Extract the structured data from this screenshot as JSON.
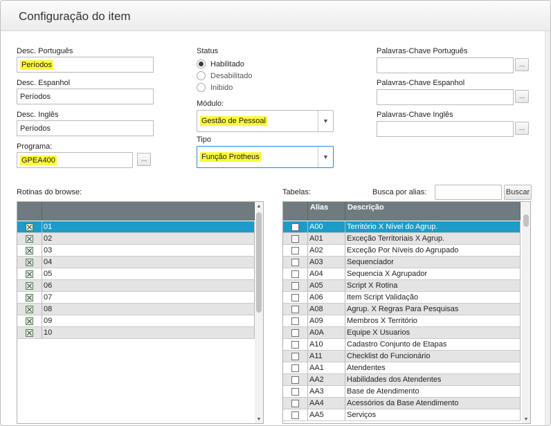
{
  "window": {
    "title": "Configuração do item"
  },
  "form": {
    "desc_pt": {
      "label": "Desc. Português",
      "value": "Períodos"
    },
    "desc_es": {
      "label": "Desc. Espanhol",
      "value": "Períodos"
    },
    "desc_en": {
      "label": "Desc. Inglês",
      "value": "Períodos"
    },
    "programa": {
      "label": "Programa:",
      "value": "GPEA400",
      "button": "..."
    },
    "status": {
      "label": "Status",
      "options": [
        {
          "label": "Habilitado",
          "selected": true
        },
        {
          "label": "Desabilitado",
          "selected": false
        },
        {
          "label": "Inibido",
          "selected": false
        }
      ]
    },
    "modulo": {
      "label": "Módulo:",
      "value": "Gestão de Pessoal"
    },
    "tipo": {
      "label": "Tipo",
      "value": "Função Protheus"
    },
    "kw_pt": {
      "label": "Palavras-Chave Português",
      "value": "",
      "button": "..."
    },
    "kw_es": {
      "label": "Palavras-Chave Espanhol",
      "value": "",
      "button": "..."
    },
    "kw_en": {
      "label": "Palavras-Chave Inglês",
      "value": "",
      "button": "..."
    }
  },
  "rotinas": {
    "label": "Rotinas do browse:",
    "rows": [
      {
        "value": "01",
        "checked": true,
        "selected": true
      },
      {
        "value": "02",
        "checked": true,
        "selected": false
      },
      {
        "value": "03",
        "checked": true,
        "selected": false
      },
      {
        "value": "04",
        "checked": true,
        "selected": false
      },
      {
        "value": "05",
        "checked": true,
        "selected": false
      },
      {
        "value": "06",
        "checked": true,
        "selected": false
      },
      {
        "value": "07",
        "checked": true,
        "selected": false
      },
      {
        "value": "08",
        "checked": true,
        "selected": false
      },
      {
        "value": "09",
        "checked": true,
        "selected": false
      },
      {
        "value": "10",
        "checked": true,
        "selected": false
      }
    ]
  },
  "tabelas": {
    "label": "Tabelas:",
    "search_label": "Busca por alias:",
    "search_value": "",
    "search_button": "Buscar",
    "columns": [
      "Alias",
      "Descrição"
    ],
    "rows": [
      {
        "alias": "A00",
        "desc": "Território X Nível do Agrup.",
        "selected": true
      },
      {
        "alias": "A01",
        "desc": "Exceção Territoriais X Agrup.",
        "selected": false
      },
      {
        "alias": "A02",
        "desc": "Exceção Por Níveis do Agrupado",
        "selected": false
      },
      {
        "alias": "A03",
        "desc": "Sequenciador",
        "selected": false
      },
      {
        "alias": "A04",
        "desc": "Sequencia X Agrupador",
        "selected": false
      },
      {
        "alias": "A05",
        "desc": "Script X Rotina",
        "selected": false
      },
      {
        "alias": "A06",
        "desc": "Item Script Validação",
        "selected": false
      },
      {
        "alias": "A08",
        "desc": "Agrup. X Regras Para Pesquisas",
        "selected": false
      },
      {
        "alias": "A09",
        "desc": "Membros X Território",
        "selected": false
      },
      {
        "alias": "A0A",
        "desc": "Equipe X Usuarios",
        "selected": false
      },
      {
        "alias": "A10",
        "desc": "Cadastro Conjunto de Etapas",
        "selected": false
      },
      {
        "alias": "A11",
        "desc": "Checklist do Funcionário",
        "selected": false
      },
      {
        "alias": "AA1",
        "desc": "Atendentes",
        "selected": false
      },
      {
        "alias": "AA2",
        "desc": "Habilidades dos Atendentes",
        "selected": false
      },
      {
        "alias": "AA3",
        "desc": "Base de Atendimento",
        "selected": false
      },
      {
        "alias": "AA4",
        "desc": "Acessórios da Base Atendimento",
        "selected": false
      },
      {
        "alias": "AA5",
        "desc": "Serviços",
        "selected": false
      }
    ]
  },
  "icons": {
    "scroll_up": "▲",
    "scroll_down": "▼",
    "dropdown": "▼"
  },
  "colors": {
    "highlight": "#fdf93c",
    "selection": "#1e9bc6",
    "grid_header": "#707b80",
    "focus_border": "#2b87c9"
  }
}
